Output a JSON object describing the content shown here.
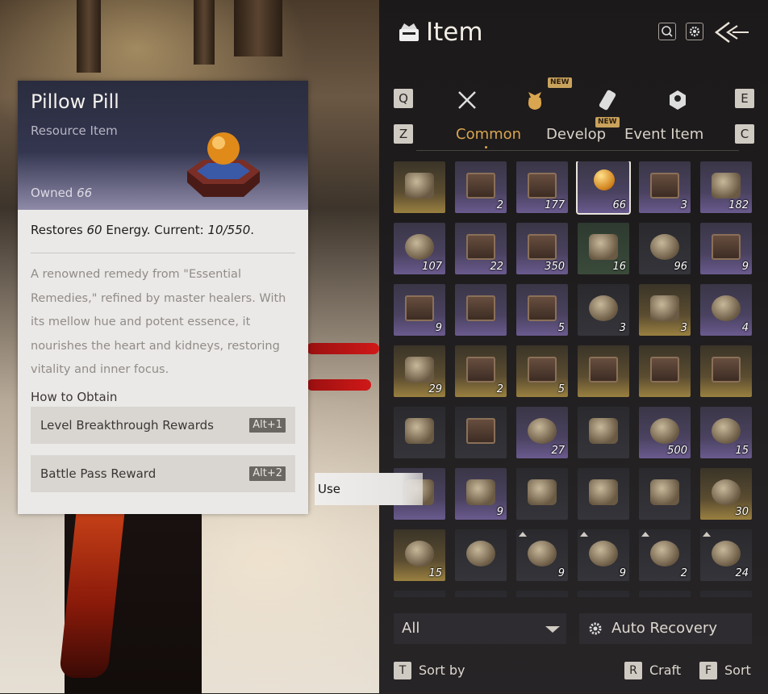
{
  "header": {
    "title": "Item",
    "search_label": "⌕",
    "settings_label": "⚙",
    "back_label": "⟨⟨"
  },
  "category_keys": {
    "prev": "Q",
    "next": "E"
  },
  "category_tabs": [
    {
      "icon": "crossed-swords-icon"
    },
    {
      "icon": "pouch-icon",
      "badge": "NEW",
      "active": true
    },
    {
      "icon": "scroll-icon"
    },
    {
      "icon": "token-icon"
    }
  ],
  "subtab_keys": {
    "prev": "Z",
    "next": "C"
  },
  "subtabs": [
    {
      "label": "Common",
      "active": true
    },
    {
      "label": "Develop",
      "badge": "NEW"
    },
    {
      "label": "Event Item"
    }
  ],
  "grid": {
    "rows": [
      [
        {
          "count": "",
          "tone": "gold",
          "art": "fish"
        },
        {
          "count": "2",
          "tone": "purple",
          "art": "chest"
        },
        {
          "count": "177",
          "tone": "purple",
          "art": "box"
        },
        {
          "count": "66",
          "tone": "purple",
          "art": "orb",
          "selected": true
        },
        {
          "count": "3",
          "tone": "purple",
          "art": "chest"
        },
        {
          "count": "182",
          "tone": "purple",
          "art": "tag"
        }
      ],
      [
        {
          "count": "107",
          "tone": "purple",
          "art": "round"
        },
        {
          "count": "22",
          "tone": "purple",
          "art": "chest"
        },
        {
          "count": "350",
          "tone": "purple",
          "art": "chest"
        },
        {
          "count": "16",
          "tone": "green",
          "art": "gold-lump"
        },
        {
          "count": "96",
          "tone": "dark",
          "art": "bowl"
        },
        {
          "count": "9",
          "tone": "purple",
          "art": "box"
        }
      ],
      [
        {
          "count": "9",
          "tone": "purple",
          "art": "chest"
        },
        {
          "count": "",
          "tone": "purple",
          "art": "chest"
        },
        {
          "count": "5",
          "tone": "purple",
          "art": "chest"
        },
        {
          "count": "3",
          "tone": "dark",
          "art": "stone"
        },
        {
          "count": "3",
          "tone": "gold",
          "art": "flute"
        },
        {
          "count": "4",
          "tone": "purple",
          "art": "jar"
        }
      ],
      [
        {
          "count": "29",
          "tone": "gold",
          "art": "banner"
        },
        {
          "count": "2",
          "tone": "gold",
          "art": "chest"
        },
        {
          "count": "5",
          "tone": "gold",
          "art": "chest"
        },
        {
          "count": "",
          "tone": "gold",
          "art": "chest"
        },
        {
          "count": "",
          "tone": "gold",
          "art": "chest"
        },
        {
          "count": "",
          "tone": "gold",
          "art": "chest"
        }
      ],
      [
        {
          "count": "",
          "tone": "dark",
          "art": "bag"
        },
        {
          "count": "",
          "tone": "dark",
          "art": "chest"
        },
        {
          "count": "27",
          "tone": "purple",
          "art": "round"
        },
        {
          "count": "",
          "tone": "dark",
          "art": "fan"
        },
        {
          "count": "500",
          "tone": "purple",
          "art": "round"
        },
        {
          "count": "15",
          "tone": "purple",
          "art": "round"
        }
      ],
      [
        {
          "count": "",
          "tone": "purple",
          "art": "book"
        },
        {
          "count": "9",
          "tone": "purple",
          "art": "banner"
        },
        {
          "count": "",
          "tone": "dark",
          "art": "gold-lump"
        },
        {
          "count": "",
          "tone": "dark",
          "art": "hair"
        },
        {
          "count": "",
          "tone": "dark",
          "art": "shoes"
        },
        {
          "count": "30",
          "tone": "gold",
          "art": "helmet"
        }
      ],
      [
        {
          "count": "15",
          "tone": "gold",
          "art": "coin"
        },
        {
          "count": "",
          "tone": "dark",
          "art": "plate"
        },
        {
          "count": "9",
          "tone": "dark",
          "art": "plate",
          "up": true
        },
        {
          "count": "9",
          "tone": "dark",
          "art": "plate",
          "up": true
        },
        {
          "count": "2",
          "tone": "dark",
          "art": "plate",
          "up": true
        },
        {
          "count": "24",
          "tone": "dark",
          "art": "plate",
          "up": true
        }
      ]
    ]
  },
  "filter": {
    "label": "All"
  },
  "auto_recovery": {
    "label": "Auto Recovery"
  },
  "bottom": {
    "sort_by_key": "T",
    "sort_by_label": "Sort by",
    "craft_key": "R",
    "craft_label": "Craft",
    "sort_key": "F",
    "sort_label": "Sort"
  },
  "detail": {
    "name": "Pillow Pill",
    "type": "Resource Item",
    "owned_label": "Owned",
    "owned_value": "66",
    "restore_prefix": "Restores",
    "restore_amount": "60",
    "restore_mid": "Energy. Current:",
    "restore_current": "10/550",
    "restore_suffix": ".",
    "description": "A renowned remedy from \"Essential Remedies,\" refined by master healers. With its mellow hue and potent essence, it nourishes the heart and kidneys, restoring vitality and inner focus.",
    "how_to_obtain": "How to Obtain",
    "sources": [
      {
        "label": "Level Breakthrough Rewards",
        "hotkey": "Alt+1"
      },
      {
        "label": "Battle Pass Reward",
        "hotkey": "Alt+2"
      }
    ]
  },
  "use_button": {
    "label": "Use"
  },
  "colors": {
    "accent": "#d9a54f",
    "panel": "#1e1c1e",
    "card": "#ebe9e7"
  }
}
